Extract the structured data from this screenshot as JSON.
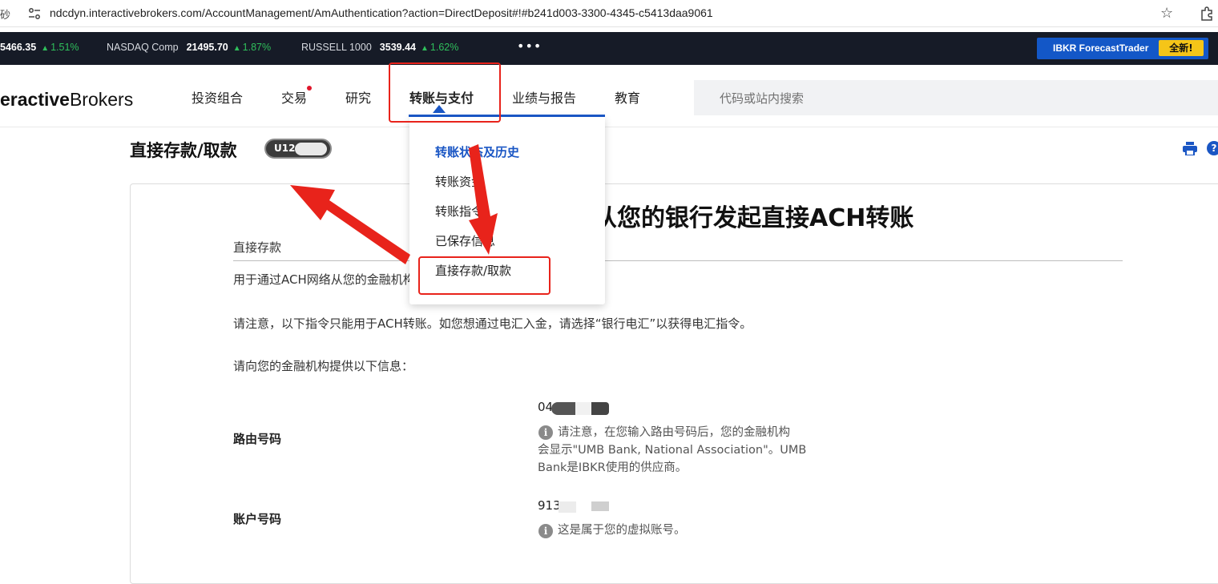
{
  "browser": {
    "left_glyph": "砂",
    "url": "ndcdyn.interactivebrokers.com/AccountManagement/AmAuthentication?action=DirectDeposit#!#b241d003-3300-4345-c5413daa9061"
  },
  "ticker": {
    "items": [
      {
        "name": "",
        "value": "5466.35",
        "change": "1.51%"
      },
      {
        "name": "NASDAQ Comp",
        "value": "21495.70",
        "change": "1.87%"
      },
      {
        "name": "RUSSELL 1000",
        "value": "3539.44",
        "change": "1.62%"
      }
    ],
    "more": "•••",
    "promo_label": "IBKR ForecastTrader",
    "promo_badge": "全新!"
  },
  "header": {
    "logo_bold": "eractive",
    "logo_regular": "Brokers",
    "nav": [
      "投资组合",
      "交易",
      "研究",
      "转账与支付",
      "业绩与报告",
      "教育"
    ],
    "active_nav": "转账与支付",
    "search_placeholder": "代码或站内搜索"
  },
  "dropdown": {
    "items": [
      "转账状态及历史",
      "转账资金",
      "转账指令",
      "已保存信息",
      "直接存款/取款"
    ],
    "selected": "转账状态及历史"
  },
  "page": {
    "title": "直接存款/取款",
    "account_prefix": "U12",
    "heading": "从您的银行发起直接ACH转账",
    "section_title": "直接存款",
    "para1": "用于通过ACH网络从您的金融机构向IBKR发起直接存款。",
    "para2": "请注意，以下指令只能用于ACH转账。如您想通过电汇入金，请选择“银行电汇”以获得电汇指令。",
    "para3": "请向您的金融机构提供以下信息：",
    "routing_label": "路由号码",
    "routing_value": "04",
    "routing_note_1": "请注意，在您输入路由号码后，您的金融机构",
    "routing_note_2": "会显示\"UMB Bank, National Association\"。UMB",
    "routing_note_3": "Bank是IBKR使用的供应商。",
    "account_label": "账户号码",
    "account_value": "913",
    "account_note": "这是属于您的虚拟账号。"
  },
  "colors": {
    "accent": "#1a56c4",
    "ticker_bg": "#161b27",
    "up": "#2fbf5b",
    "annotation": "#e8231b"
  }
}
